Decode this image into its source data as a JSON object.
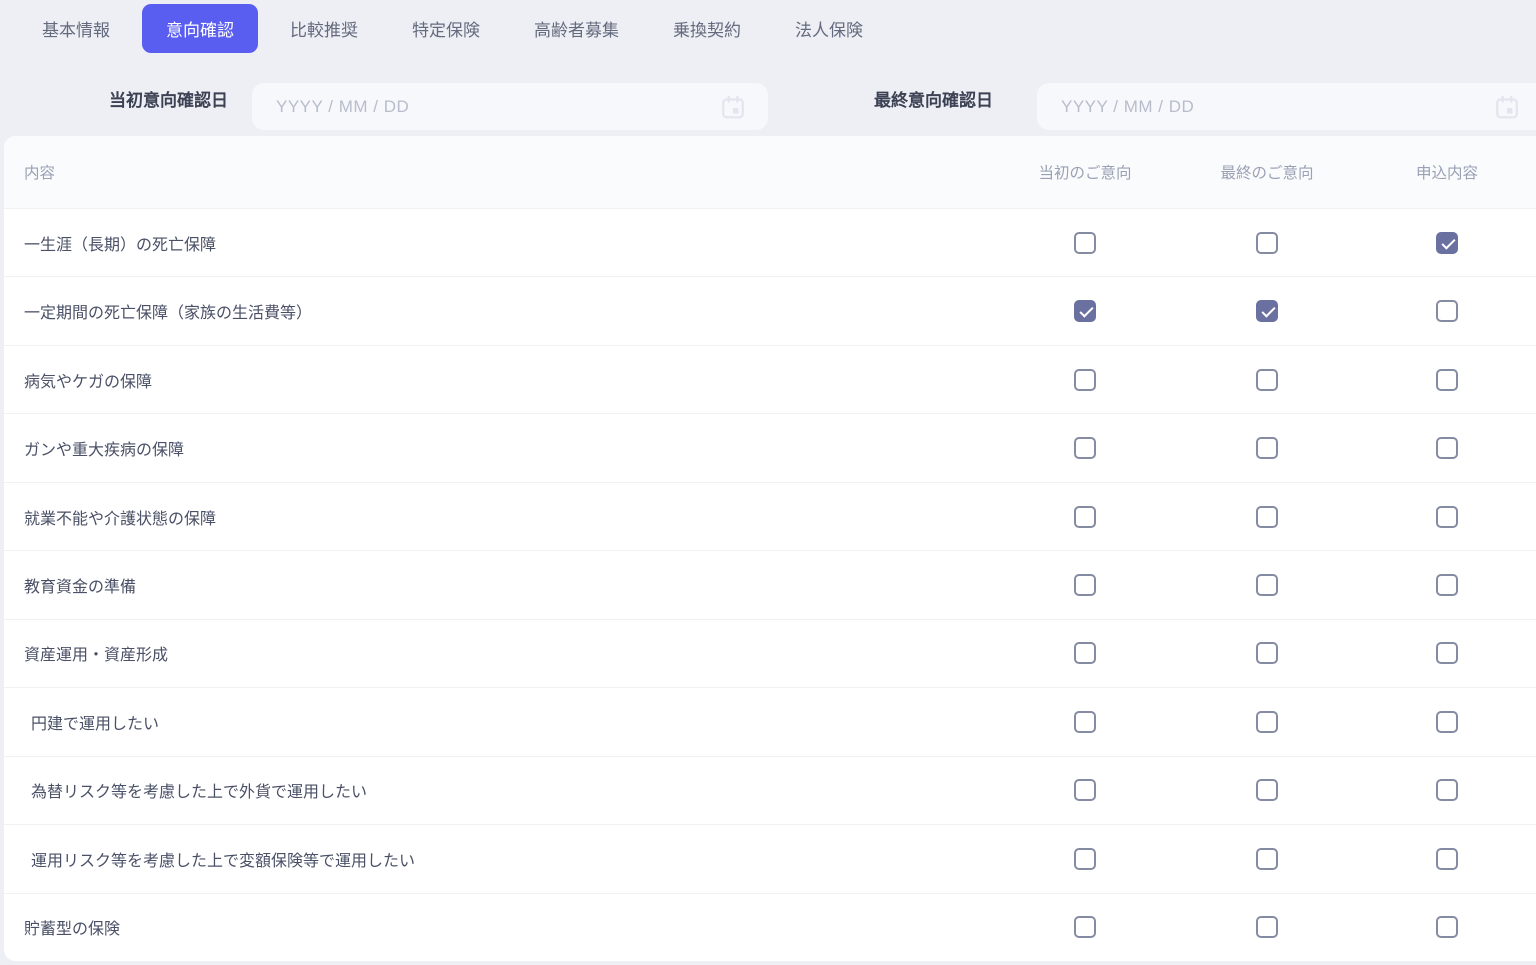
{
  "tabs": [
    {
      "label": "基本情報",
      "active": false
    },
    {
      "label": "意向確認",
      "active": true
    },
    {
      "label": "比較推奨",
      "active": false
    },
    {
      "label": "特定保険",
      "active": false
    },
    {
      "label": "高齢者募集",
      "active": false
    },
    {
      "label": "乗換契約",
      "active": false
    },
    {
      "label": "法人保険",
      "active": false
    }
  ],
  "filters": {
    "initial": {
      "label": "当初意向確認日",
      "placeholder": "YYYY / MM / DD"
    },
    "final": {
      "label": "最終意向確認日",
      "placeholder": "YYYY / MM / DD"
    }
  },
  "table": {
    "headers": {
      "content": "内容",
      "initial": "当初のご意向",
      "final": "最終のご意向",
      "application": "申込内容"
    },
    "rows": [
      {
        "label": "一生涯（長期）の死亡保障",
        "indent": false,
        "initial": false,
        "final": false,
        "application": true
      },
      {
        "label": "一定期間の死亡保障（家族の生活費等）",
        "indent": false,
        "initial": true,
        "final": true,
        "application": false
      },
      {
        "label": "病気やケガの保障",
        "indent": false,
        "initial": false,
        "final": false,
        "application": false
      },
      {
        "label": "ガンや重大疾病の保障",
        "indent": false,
        "initial": false,
        "final": false,
        "application": false
      },
      {
        "label": "就業不能や介護状態の保障",
        "indent": false,
        "initial": false,
        "final": false,
        "application": false
      },
      {
        "label": "教育資金の準備",
        "indent": false,
        "initial": false,
        "final": false,
        "application": false
      },
      {
        "label": "資産運用・資産形成",
        "indent": false,
        "initial": false,
        "final": false,
        "application": false
      },
      {
        "label": "円建で運用したい",
        "indent": true,
        "initial": false,
        "final": false,
        "application": false
      },
      {
        "label": "為替リスク等を考慮した上で外貨で運用したい",
        "indent": true,
        "initial": false,
        "final": false,
        "application": false
      },
      {
        "label": "運用リスク等を考慮した上で変額保険等で運用したい",
        "indent": true,
        "initial": false,
        "final": false,
        "application": false
      },
      {
        "label": "貯蓄型の保険",
        "indent": false,
        "initial": false,
        "final": false,
        "application": false
      }
    ]
  },
  "colors": {
    "accent": "#5a5ef0",
    "page_bg": "#edeff4",
    "tab_text": "#646b7e",
    "label_text": "#3c4254",
    "input_bg": "#f7f8fc",
    "placeholder": "#b7bdcb",
    "header_bg": "#fafbfc",
    "header_text": "#9aa1b5",
    "row_text": "#4a5066",
    "row_border": "#f0f1f5",
    "checkbox_border": "#858ba3",
    "checkbox_checked": "#6a709f",
    "calendar_icon": "#e2e5ee"
  }
}
